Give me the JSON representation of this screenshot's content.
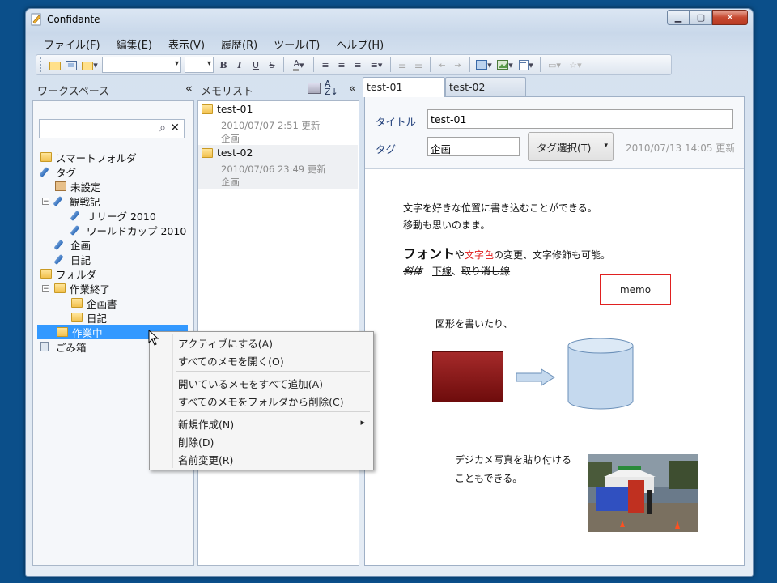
{
  "window": {
    "title": "Confidante"
  },
  "menu": [
    "ファイル(F)",
    "編集(E)",
    "表示(V)",
    "履歴(R)",
    "ツール(T)",
    "ヘルプ(H)"
  ],
  "toolbar": {
    "bold": "B",
    "italic": "I",
    "underline": "U",
    "strike": "S",
    "fontcolor": "A"
  },
  "workspace": {
    "header": "ワークスペース",
    "collapse": "«",
    "search": {
      "value": "",
      "placeholder": ""
    },
    "tree": {
      "smart": "スマートフォルダ",
      "tag": "タグ",
      "unset": "未設定",
      "kansen": "観戦記",
      "jleague": "Ｊリーグ 2010",
      "worldcup": "ワールドカップ 2010",
      "kikaku": "企画",
      "nikki": "日記",
      "folder": "フォルダ",
      "done": "作業終了",
      "kikakusho": "企画書",
      "nikki2": "日記",
      "working": "作業中",
      "trash": "ごみ箱"
    }
  },
  "memolist": {
    "header": "メモリスト",
    "collapse": "«",
    "items": [
      {
        "title": "test-01",
        "meta": "2010/07/07 2:51 更新",
        "tag": "企画"
      },
      {
        "title": "test-02",
        "meta": "2010/07/06 23:49 更新",
        "tag": "企画"
      }
    ]
  },
  "tabs": [
    "test-01",
    "test-02"
  ],
  "editor": {
    "title_label": "タイトル",
    "title_value": "test-01",
    "tag_label": "タグ",
    "tag_value": "企画",
    "tag_button": "タグ選択(T)",
    "timestamp": "2010/07/13 14:05 更新",
    "body": {
      "line1": "文字を好きな位置に書き込むことができる。",
      "line2": "移動も思いのまま。",
      "font_word": "フォント",
      "ya": "や",
      "color_word": "文字色",
      "rest": "の変更、文字修飾も可能。",
      "italic": "斜体",
      "underline": "下線",
      "comma": "、",
      "strike": "取り消し線",
      "memo": "memo",
      "shapes": "図形を書いたり、",
      "photo1": "デジカメ写真を貼り付ける",
      "photo2": "こともできる。"
    }
  },
  "context_menu": {
    "items": [
      "アクティブにする(A)",
      "すべてのメモを開く(O)",
      "開いているメモをすべて追加(A)",
      "すべてのメモをフォルダから削除(C)",
      "新規作成(N)",
      "削除(D)",
      "名前変更(R)"
    ],
    "submenu_arrow": "▸"
  },
  "colors": {
    "selection": "#3399ff",
    "accent_red": "#e02020",
    "label_blue": "#1d3c78",
    "shape_red": "#8b1a1a",
    "shape_blue": "#c5d9ee"
  }
}
